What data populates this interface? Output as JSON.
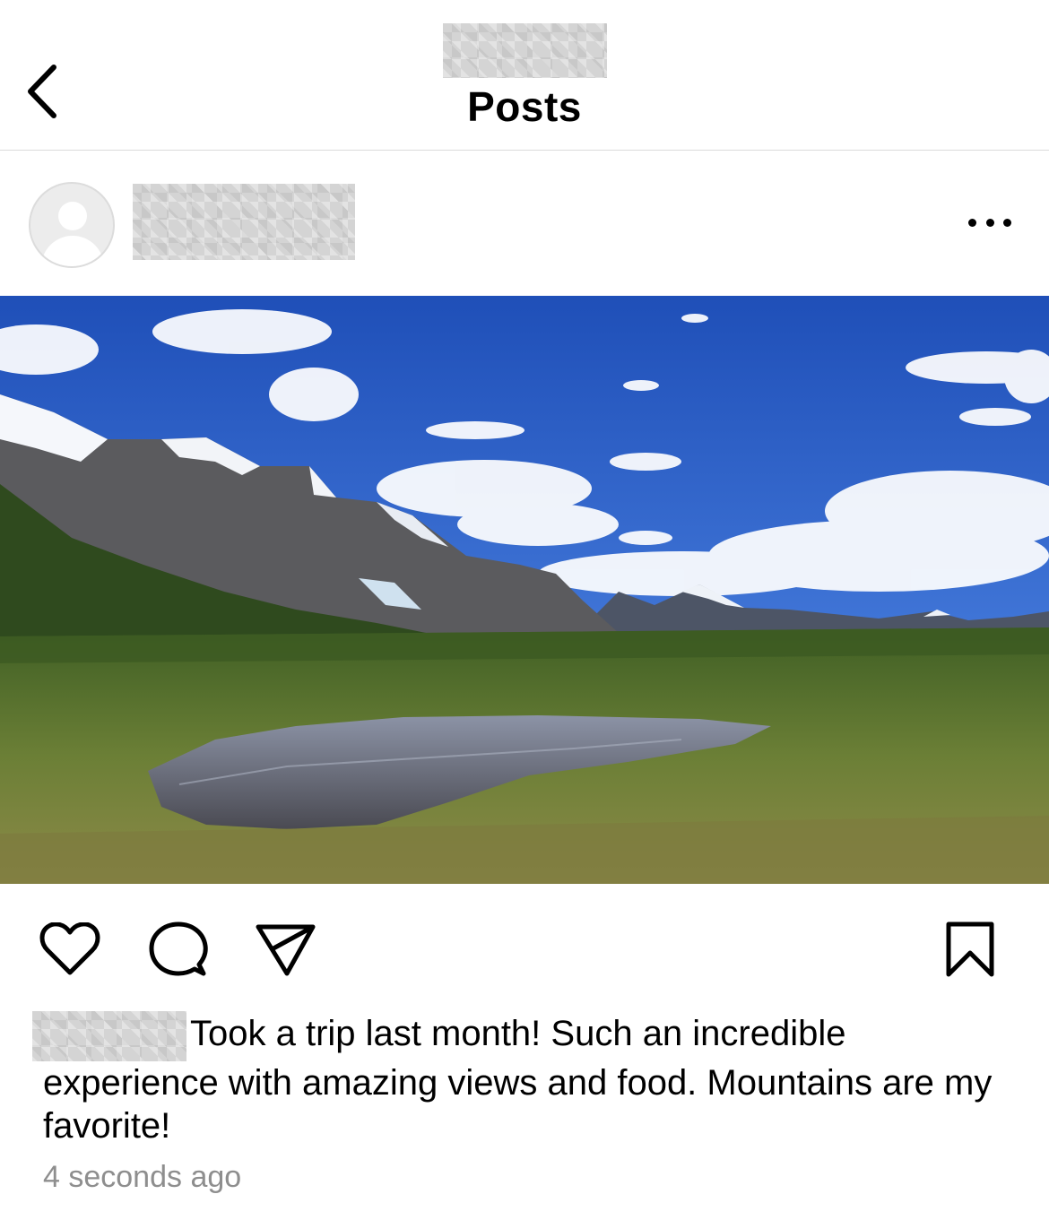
{
  "header": {
    "title": "Posts",
    "back_icon": "chevron-left-icon"
  },
  "post": {
    "more_icon": "more-horizontal-icon",
    "photo_description": "",
    "actions": {
      "like_icon": "heart-icon",
      "comment_icon": "comment-icon",
      "share_icon": "send-icon",
      "save_icon": "bookmark-icon"
    },
    "caption": "Took a trip last month! Such an incredible experience with amazing views and food. Mountains are my favorite!",
    "timestamp": "4 seconds ago"
  },
  "colors": {
    "background": "#ffffff",
    "divider": "#dbdbdb",
    "secondary_text": "#8e8e8e",
    "redaction": "#d4d4d4"
  }
}
